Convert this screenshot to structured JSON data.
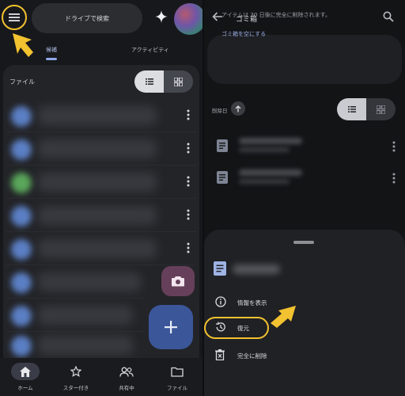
{
  "left": {
    "search_placeholder": "ドライブで検索",
    "tabs": [
      {
        "label": "候補"
      },
      {
        "label": "アクティビティ"
      }
    ],
    "files_label": "ファイル",
    "rows": [
      {
        "thumb_color": "#5b7fc4"
      },
      {
        "thumb_color": "#5b7fc4"
      },
      {
        "thumb_color": "#5aa65a"
      },
      {
        "thumb_color": "#5b7fc4"
      },
      {
        "thumb_color": "#5b7fc4"
      },
      {
        "thumb_color": "#5b7fc4"
      },
      {
        "thumb_color": "#5b7fc4"
      },
      {
        "thumb_color": "#5b7fc4"
      }
    ],
    "bottom_nav": [
      {
        "label": "ホーム",
        "icon": "home-icon",
        "active": true
      },
      {
        "label": "スター付き",
        "icon": "star-icon",
        "active": false
      },
      {
        "label": "共有中",
        "icon": "people-icon",
        "active": false
      },
      {
        "label": "ファイル",
        "icon": "folder-icon",
        "active": false
      }
    ]
  },
  "right": {
    "title": "ゴミ箱",
    "notice_text": "アイテムは 30 日後に完全に削除されます。",
    "notice_link": "ゴミ箱を空にする",
    "sort_label": "削除日",
    "menu": [
      {
        "label": "情報を表示",
        "icon": "info-icon"
      },
      {
        "label": "復元",
        "icon": "restore-icon"
      },
      {
        "label": "完全に削除",
        "icon": "delete-forever-icon"
      }
    ]
  },
  "colors": {
    "highlight": "#f2c230",
    "primary_blue": "#3b5699",
    "camera_fab": "#66405a"
  }
}
